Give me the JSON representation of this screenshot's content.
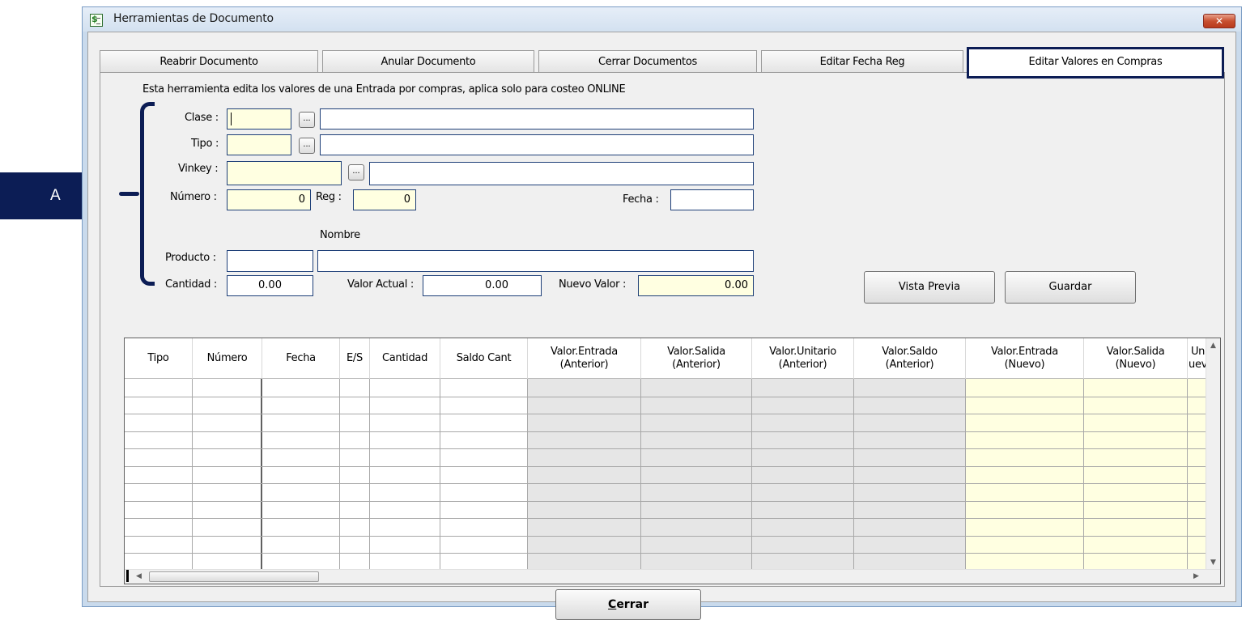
{
  "window": {
    "title": "Herramientas de Documento",
    "close_glyph": "✕"
  },
  "tabs": [
    {
      "label": "Reabrir Documento"
    },
    {
      "label": "Anular Documento"
    },
    {
      "label": "Cerrar Documentos"
    },
    {
      "label": "Editar Fecha Reg"
    },
    {
      "label": "Editar Valores en Compras",
      "active": true
    }
  ],
  "description": "Esta herramienta edita los valores de una Entrada por compras, aplica solo para costeo ONLINE",
  "form": {
    "clase_label": "Clase :",
    "tipo_label": "Tipo :",
    "vinkey_label": "Vinkey :",
    "numero_label": "Número :",
    "numero_value": "0",
    "reg_label": "Reg :",
    "reg_value": "0",
    "fecha_label": "Fecha :",
    "nombre_label": "Nombre",
    "producto_label": "Producto :",
    "cantidad_label": "Cantidad :",
    "cantidad_value": "0.00",
    "valor_actual_label": "Valor Actual :",
    "valor_actual_value": "0.00",
    "nuevo_valor_label": "Nuevo Valor :",
    "nuevo_valor_value": "0.00",
    "lookup_glyph": "..."
  },
  "buttons": {
    "vista_previa": "Vista Previa",
    "guardar": "Guardar",
    "cerrar_first": "C",
    "cerrar_rest": "errar"
  },
  "callout": {
    "label": "A"
  },
  "grid": {
    "headers": [
      "Tipo",
      "Número",
      "Fecha",
      "E/S",
      "Cantidad",
      "Saldo Cant",
      "Valor.Entrada\n(Anterior)",
      "Valor.Salida\n(Anterior)",
      "Valor.Unitario\n(Anterior)",
      "Valor.Saldo\n(Anterior)",
      "Valor.Entrada\n(Nuevo)",
      "Valor.Salida\n(Nuevo)",
      "Un\nuev"
    ],
    "row_count": 11
  },
  "colors": {
    "accent": "#0c1d55",
    "field_yellow": "#ffffe1",
    "grid_gray": "#e6e6e6"
  }
}
